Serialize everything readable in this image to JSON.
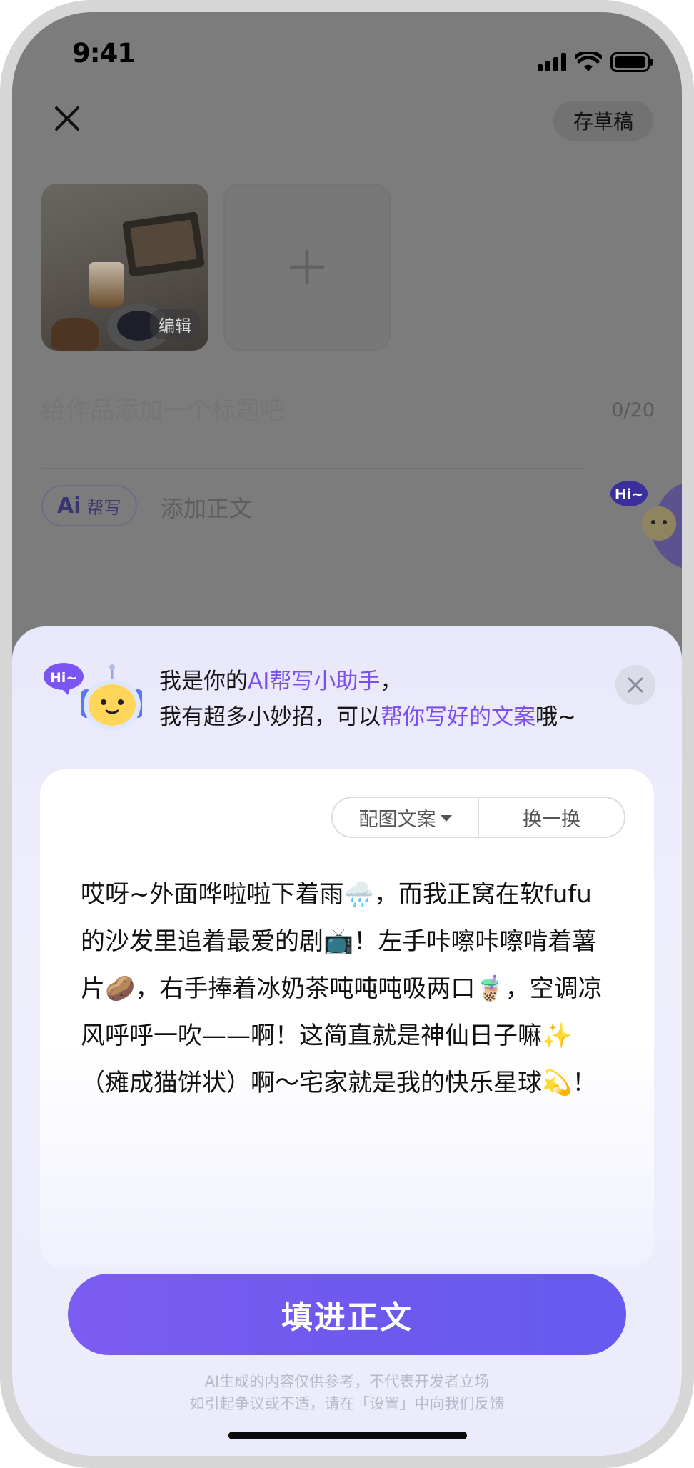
{
  "status_bar": {
    "time": "9:41"
  },
  "header": {
    "draft_label": "存草稿"
  },
  "media": {
    "edit_label": "编辑"
  },
  "title_field": {
    "placeholder": "给作品添加一个标题吧",
    "counter": "0/20"
  },
  "body_field": {
    "ai_mark": "Ai",
    "ai_label": "帮写",
    "placeholder": "添加正文"
  },
  "mascot": {
    "bubble": "Hi~"
  },
  "sheet": {
    "greeting_line1_prefix": "我是你的",
    "greeting_line1_highlight": "AI帮写小助手",
    "greeting_line1_suffix": "，",
    "greeting_line2_prefix": "我有超多小妙招，可以",
    "greeting_line2_highlight": "帮你写好的文案",
    "greeting_line2_suffix": "哦~",
    "style_option": "配图文案",
    "refresh_label": "换一换",
    "generated_text": "哎呀~外面哗啦啦下着雨🌧️，而我正窝在软fufu的沙发里追着最爱的剧📺！左手咔嚓咔嚓啃着薯片🥔，右手捧着冰奶茶吨吨吨吸两口🧋，空调凉风呼呼一吹——啊！这简直就是神仙日子嘛✨（瘫成猫饼状）啊～宅家就是我的快乐星球💫！",
    "fill_button": "填进正文",
    "disclaimer_line1": "AI生成的内容仅供参考，不代表开发者立场",
    "disclaimer_line2": "如引起争议或不适，请在「设置」中向我们反馈"
  },
  "colors": {
    "accent": "#7b4ef0",
    "button": "#6f59ee",
    "sheet_bg": "#ebebfb",
    "overlay": "#7c7c7c"
  }
}
